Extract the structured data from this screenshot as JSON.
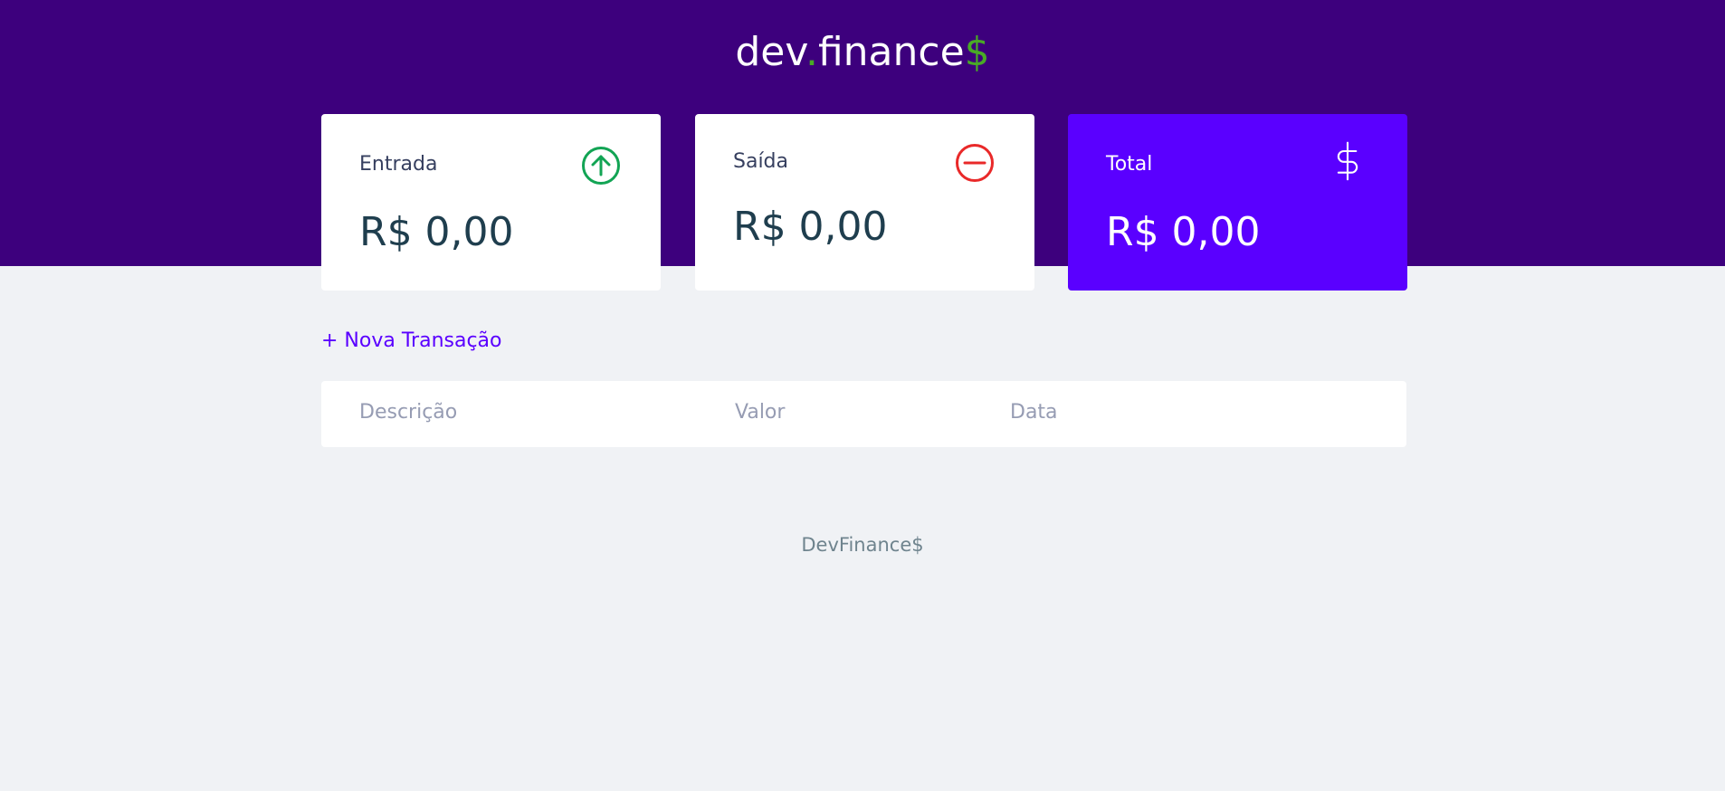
{
  "header": {
    "logo_main": "dev",
    "logo_dot": ".",
    "logo_rest": "finance",
    "logo_dollar": "$",
    "background_color": "#3D007D"
  },
  "cards": {
    "income": {
      "label": "Entrada",
      "value": "R$ 0,00",
      "icon": "arrow-up-circle-icon",
      "icon_color": "#12A454"
    },
    "expense": {
      "label": "Saída",
      "value": "R$ 0,00",
      "icon": "minus-circle-icon",
      "icon_color": "#E92929"
    },
    "total": {
      "label": "Total",
      "value": "R$ 0,00",
      "icon": "dollar-icon",
      "background_color": "#5A00FF"
    }
  },
  "actions": {
    "new_transaction": "+ Nova Transação"
  },
  "table": {
    "columns": [
      "Descrição",
      "Valor",
      "Data"
    ]
  },
  "footer": {
    "text": "DevFinance$"
  }
}
